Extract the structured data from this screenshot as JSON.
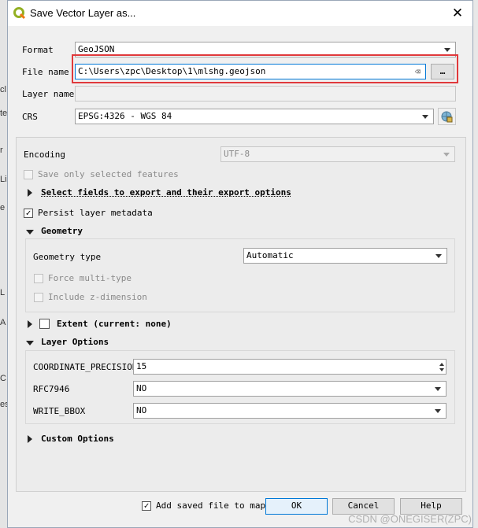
{
  "window": {
    "title": "Save Vector Layer as..."
  },
  "form": {
    "format_label": "Format",
    "format_value": "GeoJSON",
    "filename_label": "File name",
    "filename_value": "C:\\Users\\zpc\\Desktop\\1\\mlshg.geojson",
    "browse_label": "…",
    "layername_label": "Layer name",
    "layername_value": "",
    "crs_label": "CRS",
    "crs_value": "EPSG:4326 - WGS 84"
  },
  "options": {
    "encoding_label": "Encoding",
    "encoding_value": "UTF-8",
    "save_selected_label": "Save only selected features",
    "select_fields_label": "Select fields to export and their export options",
    "persist_label": "Persist layer metadata"
  },
  "geometry": {
    "section_label": "Geometry",
    "type_label": "Geometry type",
    "type_value": "Automatic",
    "force_multi_label": "Force multi-type",
    "include_z_label": "Include z-dimension"
  },
  "extent": {
    "label": "Extent (current: none)"
  },
  "layer_options": {
    "section_label": "Layer Options",
    "coord_precision_label": "COORDINATE_PRECISION",
    "coord_precision_value": "15",
    "rfc_label": "RFC7946",
    "rfc_value": "NO",
    "bbox_label": "WRITE_BBOX",
    "bbox_value": "NO"
  },
  "custom_options": {
    "label": "Custom Options"
  },
  "footer": {
    "add_saved_label": "Add saved file to map",
    "ok_label": "OK",
    "cancel_label": "Cancel",
    "help_label": "Help"
  },
  "background_fragments": [
    "cl",
    "te",
    "r",
    "Li",
    "e",
    "L",
    "A",
    "C",
    "es"
  ],
  "watermark": "CSDN @ONEGISER(ZPC)",
  "colors": {
    "highlight_box": "#e0393b",
    "accent": "#0078d7"
  }
}
